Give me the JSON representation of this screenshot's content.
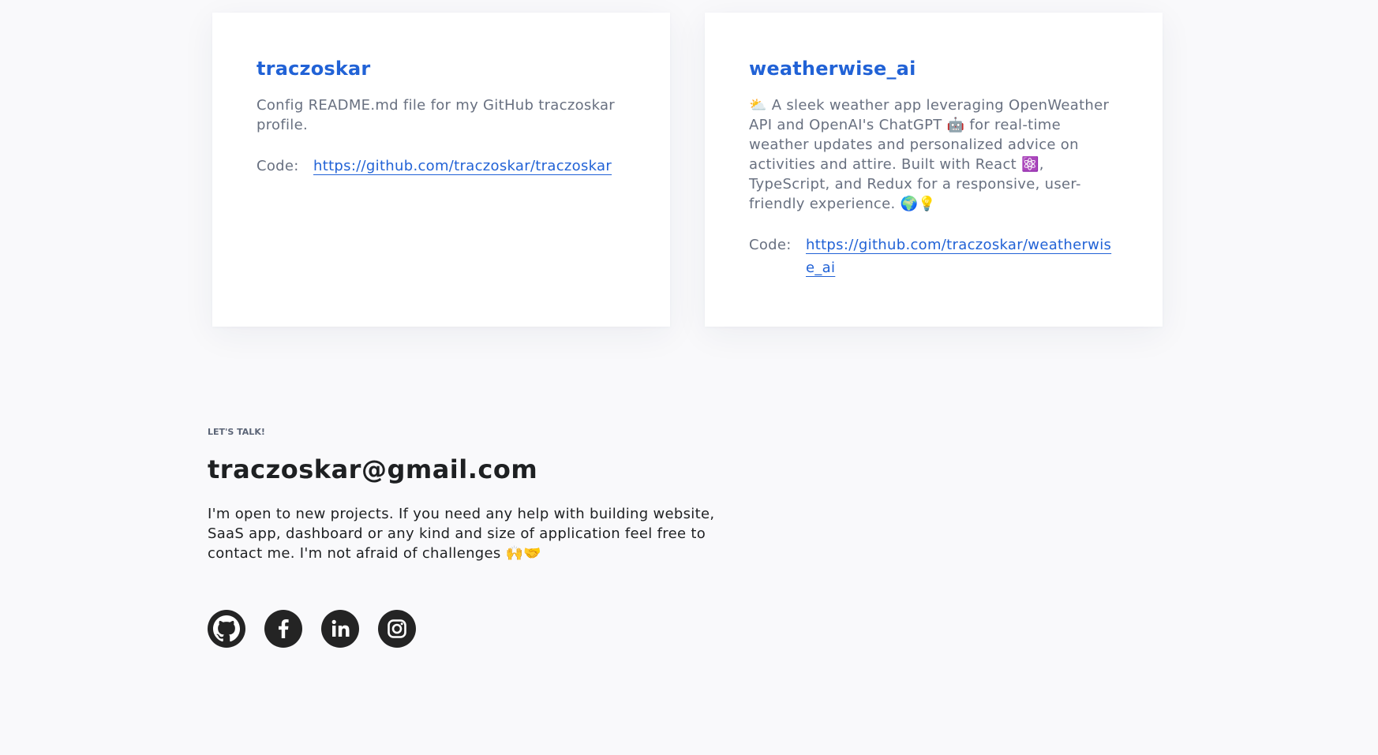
{
  "projects": [
    {
      "title": "traczoskar",
      "description": "Config README.md file for my GitHub traczoskar profile.",
      "code_label": "Code:",
      "code_url": "https://github.com/traczoskar/traczoskar"
    },
    {
      "title": "weatherwise_ai",
      "description": "⛅ A sleek weather app leveraging OpenWeather API and OpenAI's ChatGPT 🤖 for real-time weather updates and personalized advice on activities and attire. Built with React ⚛️, TypeScript, and Redux for a responsive, user-friendly experience. 🌍💡",
      "code_label": "Code:",
      "code_url": "https://github.com/traczoskar/weatherwise_ai"
    }
  ],
  "contact": {
    "eyebrow": "LET'S TALK!",
    "email": "traczoskar@gmail.com",
    "pitch": "I'm open to new projects. If you need any help with building website, SaaS app, dashboard or any kind and size of application feel free to contact me. I'm not afraid of challenges 🙌🤝"
  },
  "socials": [
    {
      "icon": "github-icon"
    },
    {
      "icon": "facebook-icon"
    },
    {
      "icon": "linkedin-icon"
    },
    {
      "icon": "instagram-icon"
    }
  ],
  "colors": {
    "accent": "#2162d6",
    "background": "#f9f9fb",
    "card": "#ffffff",
    "text_dark": "#1e2022",
    "text_muted": "#687080",
    "icon_bg": "#242424"
  }
}
